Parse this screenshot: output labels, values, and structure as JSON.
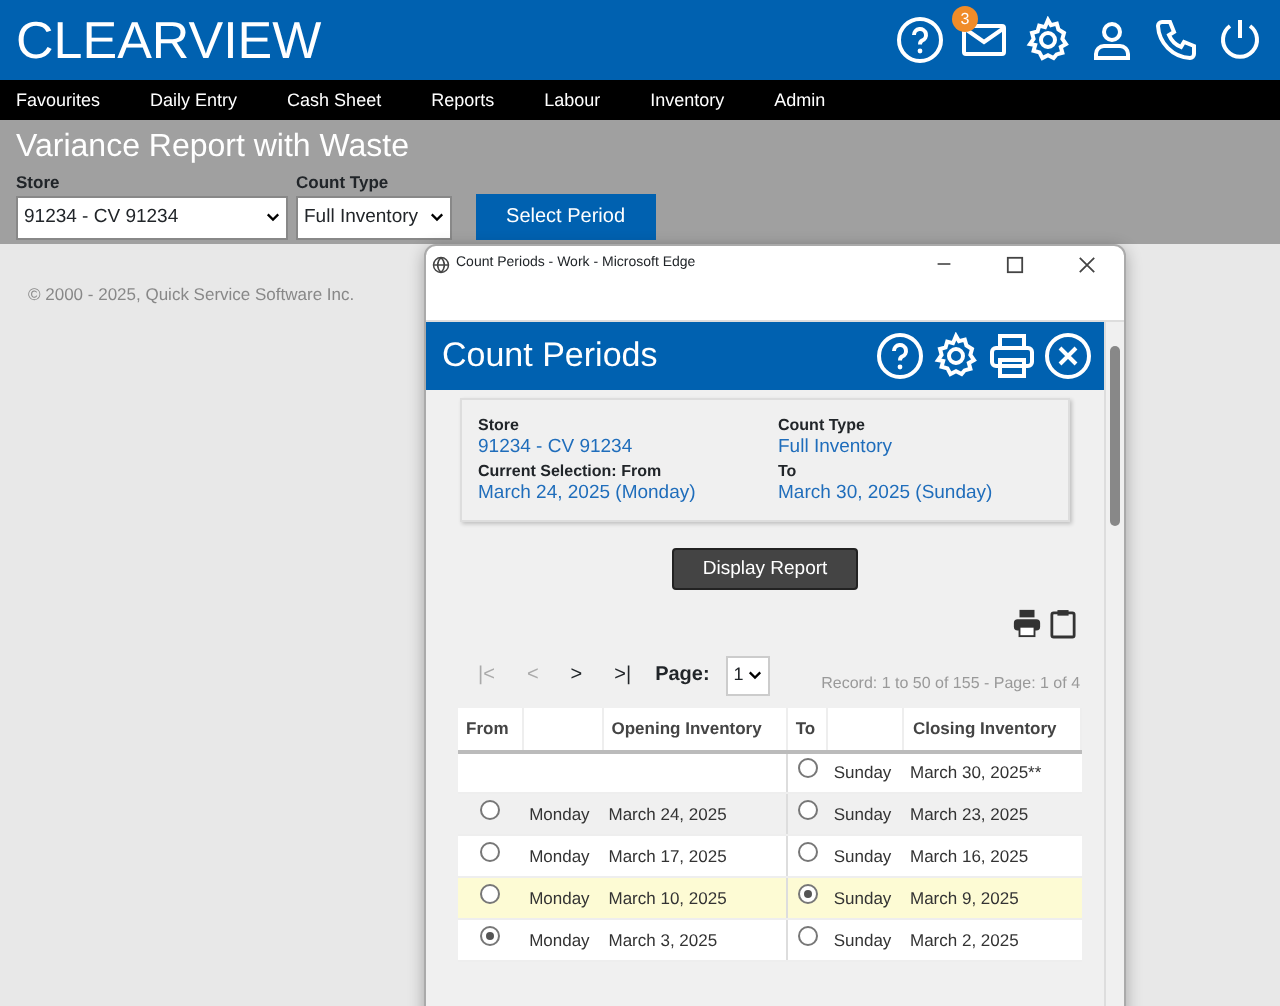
{
  "app": {
    "logo": "CLEARVIEW",
    "mail_count": "3"
  },
  "menu": [
    "Favourites",
    "Daily Entry",
    "Cash Sheet",
    "Reports",
    "Labour",
    "Inventory",
    "Admin"
  ],
  "page": {
    "title": "Variance Report with Waste",
    "store_label": "Store",
    "store_value": "91234 - CV 91234",
    "count_type_label": "Count Type",
    "count_type_value": "Full Inventory",
    "button": "Select Period"
  },
  "footer": "© 2000 - 2025, Quick Service Software Inc.",
  "popup": {
    "window_title": "Count Periods - Work - Microsoft Edge",
    "title": "Count Periods",
    "summary": [
      {
        "label": "Store",
        "value": "91234 - CV 91234"
      },
      {
        "label": "Count Type",
        "value": "Full Inventory"
      },
      {
        "label": "Current Selection: From",
        "value": "March 24, 2025 (Monday)"
      },
      {
        "label": "To",
        "value": "March 30, 2025 (Sunday)"
      }
    ],
    "display_button": "Display Report",
    "pager": [
      {
        "label": "|<",
        "disabled": true
      },
      {
        "label": "<",
        "disabled": true
      },
      {
        "label": ">",
        "disabled": false
      },
      {
        "label": ">|",
        "disabled": false
      }
    ],
    "page_label": "Page:",
    "page_value": "1",
    "record_info": "Record: 1 to 50 of 155 - Page: 1 of 4",
    "columns": [
      "From",
      "",
      "Opening Inventory",
      "To",
      "",
      "Closing Inventory"
    ],
    "rows": [
      {
        "current": false,
        "highlighted": false,
        "to": {
          "day": "Sunday",
          "date": "March 30, 2025**",
          "selected": false
        }
      },
      {
        "current": true,
        "highlighted": false,
        "from": {
          "day": "Monday",
          "date": "March 24, 2025",
          "selected": false
        },
        "to": {
          "day": "Sunday",
          "date": "March 23, 2025",
          "selected": false
        }
      },
      {
        "current": false,
        "highlighted": false,
        "from": {
          "day": "Monday",
          "date": "March 17, 2025",
          "selected": false
        },
        "to": {
          "day": "Sunday",
          "date": "March 16, 2025",
          "selected": false
        }
      },
      {
        "current": false,
        "highlighted": true,
        "from": {
          "day": "Monday",
          "date": "March 10, 2025",
          "selected": false
        },
        "to": {
          "day": "Sunday",
          "date": "March 9, 2025",
          "selected": true
        }
      },
      {
        "current": false,
        "highlighted": false,
        "from": {
          "day": "Monday",
          "date": "March 3, 2025",
          "selected": true
        },
        "to": {
          "day": "Sunday",
          "date": "March 2, 2025",
          "selected": false
        }
      }
    ]
  }
}
